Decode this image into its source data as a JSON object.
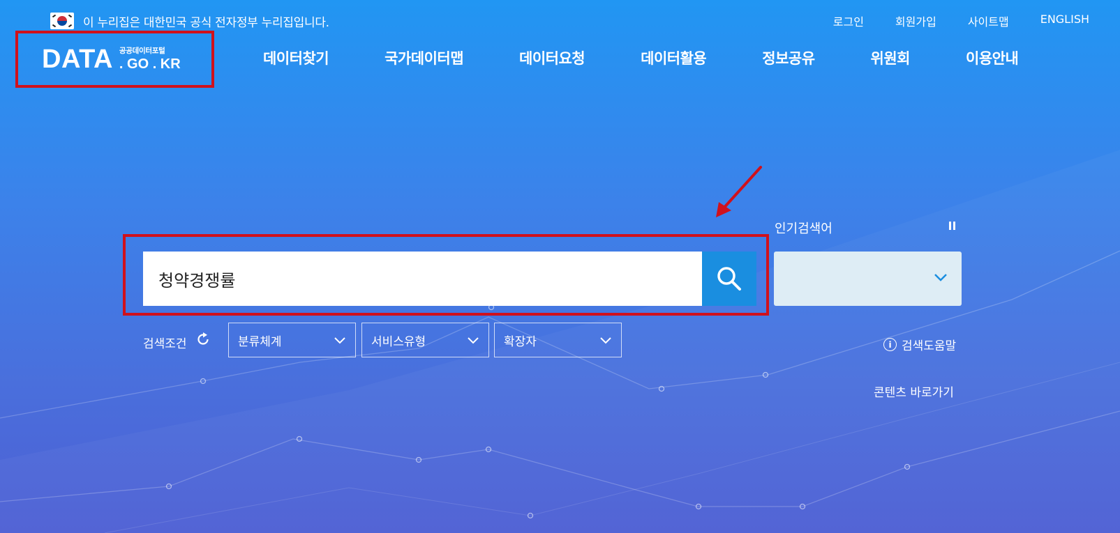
{
  "gov_notice": {
    "text": "이 누리집은 대한민국 공식 전자정부 누리집입니다."
  },
  "util_links": [
    "로그인",
    "회원가입",
    "사이트맵",
    "ENGLISH"
  ],
  "logo": {
    "main": "DATA",
    "sub": "공공데이터포털",
    "domain": ". GO . KR"
  },
  "nav": [
    "데이터찾기",
    "국가데이터맵",
    "데이터요청",
    "데이터활용",
    "정보공유",
    "위원회",
    "이용안내"
  ],
  "search": {
    "value": "청약경쟁률"
  },
  "popular": {
    "label": "인기검색어",
    "selected": ""
  },
  "filters": {
    "label": "검색조건",
    "dropdowns": [
      "분류체계",
      "서비스유형",
      "확장자"
    ]
  },
  "help": {
    "label": "검색도움말",
    "info_glyph": "i"
  },
  "shortcut": {
    "label": "콘텐츠 바로가기"
  },
  "colors": {
    "highlight": "#d0111c",
    "search_button": "#1a8ee0",
    "popular_select_bg": "#deedf5"
  }
}
